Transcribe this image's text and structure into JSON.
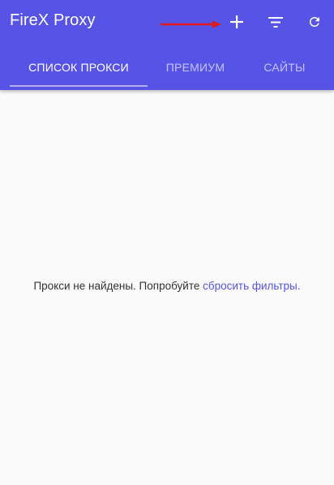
{
  "app": {
    "title": "FireX Proxy"
  },
  "colors": {
    "appbar": "#5753e6",
    "background": "#fafafa",
    "annotation_arrow": "#e0191c",
    "link": "#5753e6"
  },
  "toolbar": {
    "add_icon": "plus-icon",
    "filter_icon": "filter-icon",
    "refresh_icon": "refresh-icon"
  },
  "tabs": [
    {
      "label": "СПИСОК ПРОКСИ",
      "active": true
    },
    {
      "label": "ПРЕМИУМ",
      "active": false
    },
    {
      "label": "САЙТЫ",
      "active": false
    }
  ],
  "empty_state": {
    "text": "Прокси не найдены. Попробуйте ",
    "link": "сбросить фильтры."
  }
}
